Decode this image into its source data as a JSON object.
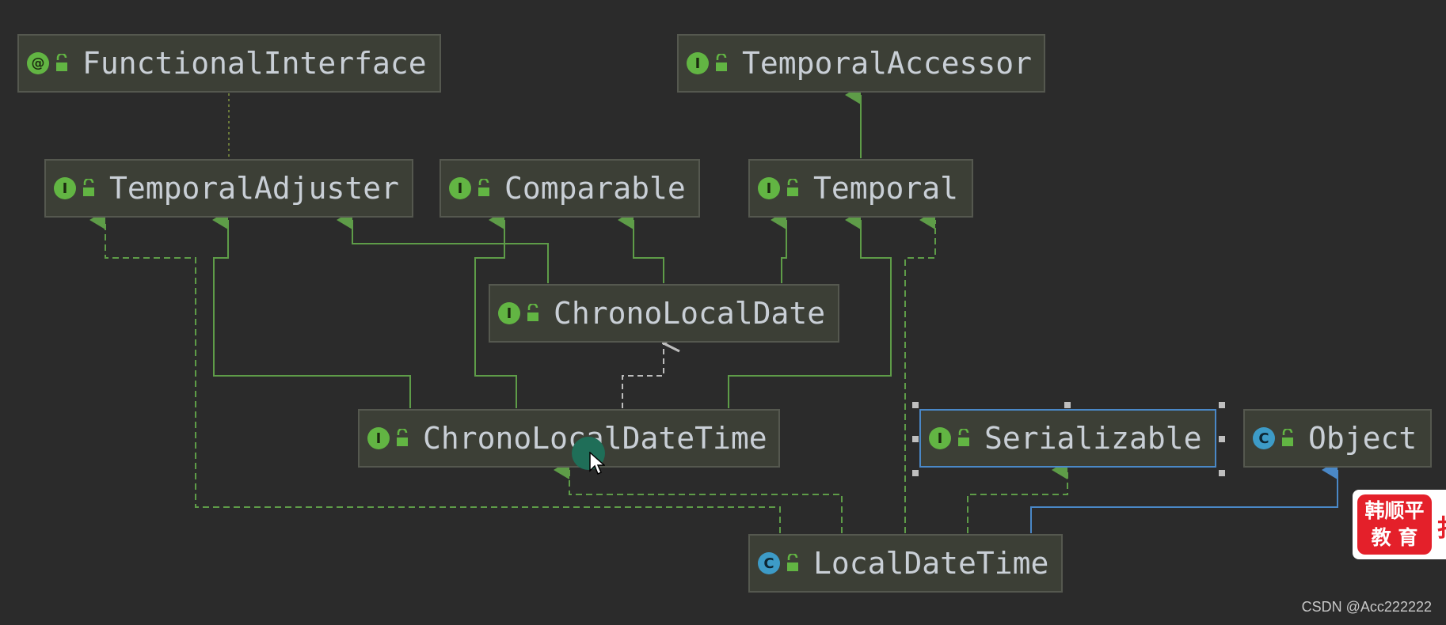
{
  "diagram": {
    "nodes": [
      {
        "id": "functional-interface",
        "label": "FunctionalInterface",
        "kind": "annotation"
      },
      {
        "id": "temporal-accessor",
        "label": "TemporalAccessor",
        "kind": "interface"
      },
      {
        "id": "temporal-adjuster",
        "label": "TemporalAdjuster",
        "kind": "interface"
      },
      {
        "id": "comparable",
        "label": "Comparable",
        "kind": "interface"
      },
      {
        "id": "temporal",
        "label": "Temporal",
        "kind": "interface"
      },
      {
        "id": "chrono-local-date",
        "label": "ChronoLocalDate",
        "kind": "interface"
      },
      {
        "id": "chrono-local-date-time",
        "label": "ChronoLocalDateTime",
        "kind": "interface"
      },
      {
        "id": "serializable",
        "label": "Serializable",
        "kind": "interface",
        "selected": true
      },
      {
        "id": "object",
        "label": "Object",
        "kind": "class"
      },
      {
        "id": "local-date-time",
        "label": "LocalDateTime",
        "kind": "class"
      }
    ],
    "edges": [
      {
        "from": "functional-interface",
        "to": "temporal-adjuster",
        "type": "annotation"
      },
      {
        "from": "temporal",
        "to": "temporal-accessor",
        "type": "extends"
      },
      {
        "from": "chrono-local-date",
        "to": "temporal-adjuster",
        "type": "extends"
      },
      {
        "from": "chrono-local-date",
        "to": "comparable",
        "type": "extends"
      },
      {
        "from": "chrono-local-date",
        "to": "temporal",
        "type": "extends"
      },
      {
        "from": "chrono-local-date-time",
        "to": "temporal-adjuster",
        "type": "extends"
      },
      {
        "from": "chrono-local-date-time",
        "to": "comparable",
        "type": "extends"
      },
      {
        "from": "chrono-local-date-time",
        "to": "temporal",
        "type": "extends"
      },
      {
        "from": "chrono-local-date-time",
        "to": "chrono-local-date",
        "type": "dependency"
      },
      {
        "from": "local-date-time",
        "to": "temporal-adjuster",
        "type": "implements"
      },
      {
        "from": "local-date-time",
        "to": "chrono-local-date-time",
        "type": "implements"
      },
      {
        "from": "local-date-time",
        "to": "temporal",
        "type": "implements"
      },
      {
        "from": "local-date-time",
        "to": "serializable",
        "type": "implements"
      },
      {
        "from": "local-date-time",
        "to": "object",
        "type": "extends-class"
      }
    ],
    "colors": {
      "background": "#2b2b2b",
      "node_fill": "#3c3f36",
      "node_border": "#55584f",
      "edge_green": "#5e9c48",
      "edge_blue": "#4a88c7",
      "edge_dependency": "#9a9a9a",
      "edge_annotation": "#6b7a3a"
    }
  },
  "watermark": {
    "logo_line1": "韩顺平",
    "logo_line2": "教 育",
    "credit": "CSDN @Acc222222"
  }
}
